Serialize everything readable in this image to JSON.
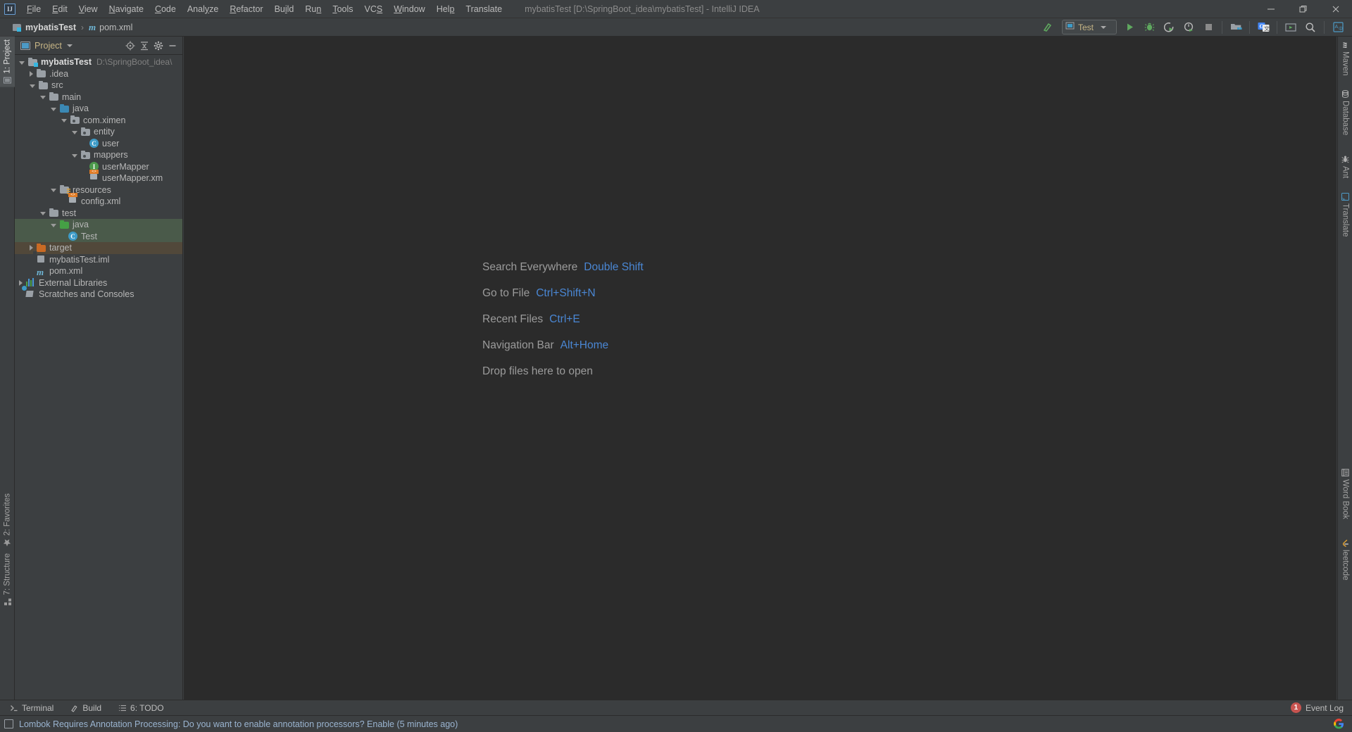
{
  "window": {
    "title": "mybatisTest [D:\\SpringBoot_idea\\mybatisTest] - IntelliJ IDEA",
    "logo": "IJ",
    "controls": {
      "minimize": "minimize-icon",
      "maximize": "maximize-icon",
      "close": "close-icon"
    }
  },
  "menubar": {
    "items": [
      {
        "label": "File"
      },
      {
        "label": "Edit"
      },
      {
        "label": "View"
      },
      {
        "label": "Navigate"
      },
      {
        "label": "Code"
      },
      {
        "label": "Analyze"
      },
      {
        "label": "Refactor"
      },
      {
        "label": "Build"
      },
      {
        "label": "Run"
      },
      {
        "label": "Tools"
      },
      {
        "label": "VCS"
      },
      {
        "label": "Window"
      },
      {
        "label": "Help"
      },
      {
        "label": "Translate"
      }
    ]
  },
  "navbar": {
    "breadcrumb": [
      {
        "label": "mybatisTest",
        "icon": "module-icon"
      },
      {
        "label": "pom.xml",
        "icon": "maven-icon"
      }
    ],
    "separator": "›",
    "run_config": {
      "label": "Test",
      "icon": "run-config-icon"
    },
    "buttons": [
      {
        "name": "build-icon"
      },
      {
        "name": "run-icon"
      },
      {
        "name": "debug-icon"
      },
      {
        "name": "run-with-coverage-icon"
      },
      {
        "name": "profile-icon"
      },
      {
        "name": "stop-icon"
      },
      {
        "name": "project-structure-icon"
      },
      {
        "name": "google-translate-icon"
      },
      {
        "name": "presentation-icon"
      },
      {
        "name": "search-icon"
      },
      {
        "name": "translate-toggle-icon"
      }
    ]
  },
  "left_strip": {
    "tabs": [
      {
        "label": "1: Project",
        "mnemonic": "1",
        "active": true,
        "icon": "project-icon"
      },
      {
        "label": "2: Favorites",
        "mnemonic": "2",
        "active": false,
        "icon": "star-icon"
      },
      {
        "label": "7: Structure",
        "mnemonic": "7",
        "active": false,
        "icon": "structure-icon"
      }
    ]
  },
  "right_strip": {
    "tabs": [
      {
        "label": "Maven",
        "icon": "maven-icon"
      },
      {
        "label": "Database",
        "icon": "database-icon"
      },
      {
        "label": "Ant",
        "icon": "ant-icon"
      },
      {
        "label": "Translate",
        "icon": "translate-icon"
      },
      {
        "label": "Word Book",
        "icon": "word-book-icon"
      },
      {
        "label": "leetcode",
        "icon": "leetcode-icon"
      }
    ]
  },
  "project_panel": {
    "title": "Project",
    "tools": [
      {
        "name": "locate-icon"
      },
      {
        "name": "collapse-all-icon"
      },
      {
        "name": "settings-gear-icon"
      },
      {
        "name": "hide-panel-icon"
      }
    ],
    "tree": [
      {
        "depth": 0,
        "arrow": "open",
        "icon": "module-folder",
        "label": "mybatisTest",
        "bold": true,
        "path": "D:\\SpringBoot_idea\\",
        "sel": ""
      },
      {
        "depth": 1,
        "arrow": "closed",
        "icon": "folder-grey",
        "label": ".idea",
        "bold": false,
        "path": "",
        "sel": ""
      },
      {
        "depth": 1,
        "arrow": "open",
        "icon": "folder-grey",
        "label": "src",
        "bold": false,
        "path": "",
        "sel": ""
      },
      {
        "depth": 2,
        "arrow": "open",
        "icon": "folder-grey",
        "label": "main",
        "bold": false,
        "path": "",
        "sel": ""
      },
      {
        "depth": 3,
        "arrow": "open",
        "icon": "folder-blue",
        "label": "java",
        "bold": false,
        "path": "",
        "sel": ""
      },
      {
        "depth": 4,
        "arrow": "open",
        "icon": "package",
        "label": "com.ximen",
        "bold": false,
        "path": "",
        "sel": ""
      },
      {
        "depth": 5,
        "arrow": "open",
        "icon": "package",
        "label": "entity",
        "bold": false,
        "path": "",
        "sel": ""
      },
      {
        "depth": 6,
        "arrow": "none",
        "icon": "class-c",
        "label": "user",
        "bold": false,
        "path": "",
        "sel": ""
      },
      {
        "depth": 5,
        "arrow": "open",
        "icon": "package",
        "label": "mappers",
        "bold": false,
        "path": "",
        "sel": ""
      },
      {
        "depth": 6,
        "arrow": "none",
        "icon": "interface-i",
        "label": "userMapper",
        "bold": false,
        "path": "",
        "sel": ""
      },
      {
        "depth": 6,
        "arrow": "none",
        "icon": "xml",
        "label": "userMapper.xm",
        "bold": false,
        "path": "",
        "sel": ""
      },
      {
        "depth": 3,
        "arrow": "open",
        "icon": "folder-res",
        "label": "resources",
        "bold": false,
        "path": "",
        "sel": ""
      },
      {
        "depth": 4,
        "arrow": "none",
        "icon": "xml",
        "label": "config.xml",
        "bold": false,
        "path": "",
        "sel": ""
      },
      {
        "depth": 2,
        "arrow": "open",
        "icon": "folder-grey",
        "label": "test",
        "bold": false,
        "path": "",
        "sel": ""
      },
      {
        "depth": 3,
        "arrow": "open",
        "icon": "folder-green",
        "label": "java",
        "bold": false,
        "path": "",
        "sel": "green"
      },
      {
        "depth": 4,
        "arrow": "none",
        "icon": "test-class",
        "label": "Test",
        "bold": false,
        "path": "",
        "sel": "green"
      },
      {
        "depth": 1,
        "arrow": "closed",
        "icon": "folder-orange",
        "label": "target",
        "bold": false,
        "path": "",
        "sel": "brown"
      },
      {
        "depth": 1,
        "arrow": "none",
        "icon": "iml",
        "label": "mybatisTest.iml",
        "bold": false,
        "path": "",
        "sel": ""
      },
      {
        "depth": 1,
        "arrow": "none",
        "icon": "maven-m",
        "label": "pom.xml",
        "bold": false,
        "path": "",
        "sel": ""
      },
      {
        "depth": 0,
        "arrow": "closed",
        "icon": "libraries",
        "label": "External Libraries",
        "bold": false,
        "path": "",
        "sel": ""
      },
      {
        "depth": 0,
        "arrow": "none",
        "icon": "scratches",
        "label": "Scratches and Consoles",
        "bold": false,
        "path": "",
        "sel": ""
      }
    ]
  },
  "editor": {
    "tips": [
      {
        "name": "Search Everywhere",
        "key": "Double Shift"
      },
      {
        "name": "Go to File",
        "key": "Ctrl+Shift+N"
      },
      {
        "name": "Recent Files",
        "key": "Ctrl+E"
      },
      {
        "name": "Navigation Bar",
        "key": "Alt+Home"
      }
    ],
    "drop_hint": "Drop files here to open"
  },
  "bottom_bar": {
    "tabs": [
      {
        "label": "Terminal",
        "icon": "terminal-icon",
        "mnemonic": ""
      },
      {
        "label": "Build",
        "icon": "build-icon",
        "mnemonic": ""
      },
      {
        "label": "6: TODO",
        "icon": "todo-icon",
        "mnemonic": "6"
      }
    ],
    "event_log": {
      "label": "Event Log",
      "count": "1"
    }
  },
  "status_bar": {
    "message": "Lombok Requires Annotation Processing: Do you want to enable annotation processors? Enable (5 minutes ago)",
    "icon": "notification-icon",
    "right_icon": "google-icon"
  },
  "colors": {
    "bg_chrome": "#3c3f41",
    "bg_editor": "#2b2b2b",
    "accent_link": "#4a87d4",
    "text_primary": "#bbbbbb",
    "text_dim": "#8c8c8c",
    "select_green": "#4a5a4a",
    "select_brown": "#51483a",
    "badge_red": "#c75450",
    "config_label": "#c8b686"
  }
}
